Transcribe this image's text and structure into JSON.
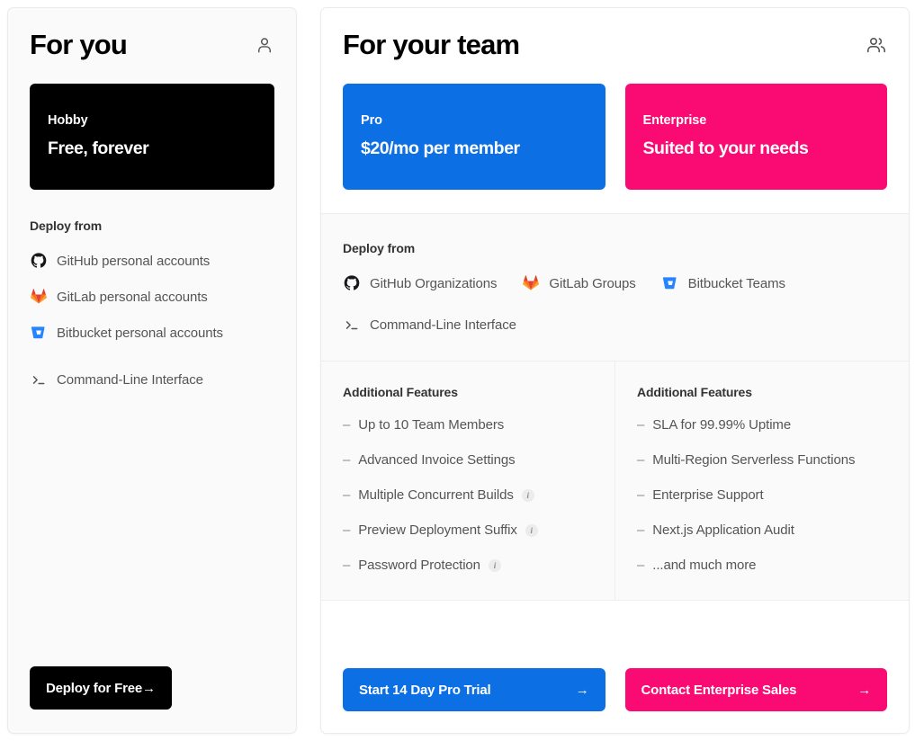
{
  "left_panel": {
    "title": "For you",
    "header_icon": "person-icon",
    "plan": {
      "name": "Hobby",
      "price": "Free, forever",
      "background": "#000000"
    },
    "deploy_from_label": "Deploy from",
    "sources": [
      {
        "icon": "github-icon",
        "label": "GitHub personal accounts"
      },
      {
        "icon": "gitlab-icon",
        "label": "GitLab personal accounts"
      },
      {
        "icon": "bitbucket-icon",
        "label": "Bitbucket personal accounts"
      }
    ],
    "cli": {
      "icon": "terminal-prompt-icon",
      "label": "Command-Line Interface"
    },
    "cta": {
      "label": "Deploy for Free",
      "arrow": "→",
      "color": "#000000"
    }
  },
  "right_panel": {
    "title": "For your team",
    "header_icon": "users-icon",
    "plans": [
      {
        "name": "Pro",
        "price": "$20/mo per member",
        "background": "#0c6fe3"
      },
      {
        "name": "Enterprise",
        "price": "Suited to your needs",
        "background": "#fa0b73"
      }
    ],
    "deploy_from_label": "Deploy from",
    "sources": [
      {
        "icon": "github-icon",
        "label": "GitHub Organizations"
      },
      {
        "icon": "gitlab-icon",
        "label": "GitLab Groups"
      },
      {
        "icon": "bitbucket-icon",
        "label": "Bitbucket Teams"
      }
    ],
    "cli": {
      "icon": "terminal-prompt-icon",
      "label": "Command-Line Interface"
    },
    "feature_columns": [
      {
        "heading": "Additional Features",
        "items": [
          {
            "label": "Up to 10 Team Members",
            "info": false
          },
          {
            "label": "Advanced Invoice Settings",
            "info": false
          },
          {
            "label": "Multiple Concurrent Builds",
            "info": true
          },
          {
            "label": "Preview Deployment Suffix",
            "info": true
          },
          {
            "label": "Password Protection",
            "info": true
          }
        ]
      },
      {
        "heading": "Additional Features",
        "items": [
          {
            "label": "SLA for 99.99% Uptime",
            "info": false
          },
          {
            "label": "Multi-Region Serverless Functions",
            "info": false
          },
          {
            "label": "Enterprise Support",
            "info": false
          },
          {
            "label": "Next.js Application Audit",
            "info": false
          },
          {
            "label": "...and much more",
            "info": false
          }
        ]
      }
    ],
    "ctas": [
      {
        "label": "Start 14 Day Pro Trial",
        "arrow": "→",
        "color": "#0c6fe3"
      },
      {
        "label": "Contact Enterprise Sales",
        "arrow": "→",
        "color": "#fa0b73"
      }
    ]
  },
  "info_badge_glyph": "i",
  "bullet_dash": "–"
}
